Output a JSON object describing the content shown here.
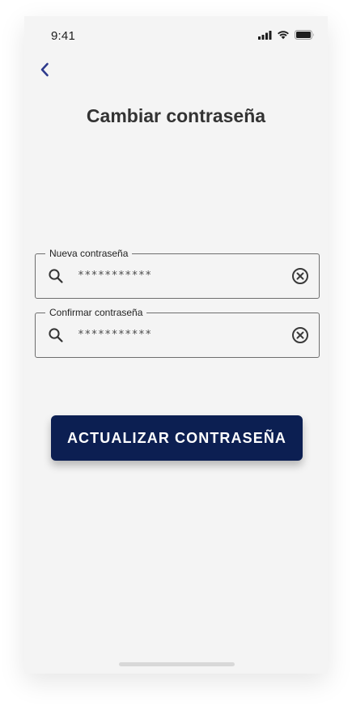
{
  "status_bar": {
    "time": "9:41",
    "icons": [
      "cellular-signal-icon",
      "wifi-icon",
      "battery-icon"
    ]
  },
  "header": {
    "back_icon": "chevron-left-icon",
    "title": "Cambiar contraseña"
  },
  "form": {
    "new_password": {
      "label": "Nueva contraseña",
      "value": "***********",
      "icon": "search-icon",
      "clear_icon": "clear-circle-icon"
    },
    "confirm_password": {
      "label": "Confirmar contraseña",
      "value": "***********",
      "icon": "search-icon",
      "clear_icon": "clear-circle-icon"
    }
  },
  "actions": {
    "submit_label": "ACTUALIZAR CONTRASEÑA"
  },
  "colors": {
    "primary": "#0c1f52",
    "accent_back": "#2d3a8c",
    "background": "#f4f4f4",
    "title_text": "#333333"
  }
}
